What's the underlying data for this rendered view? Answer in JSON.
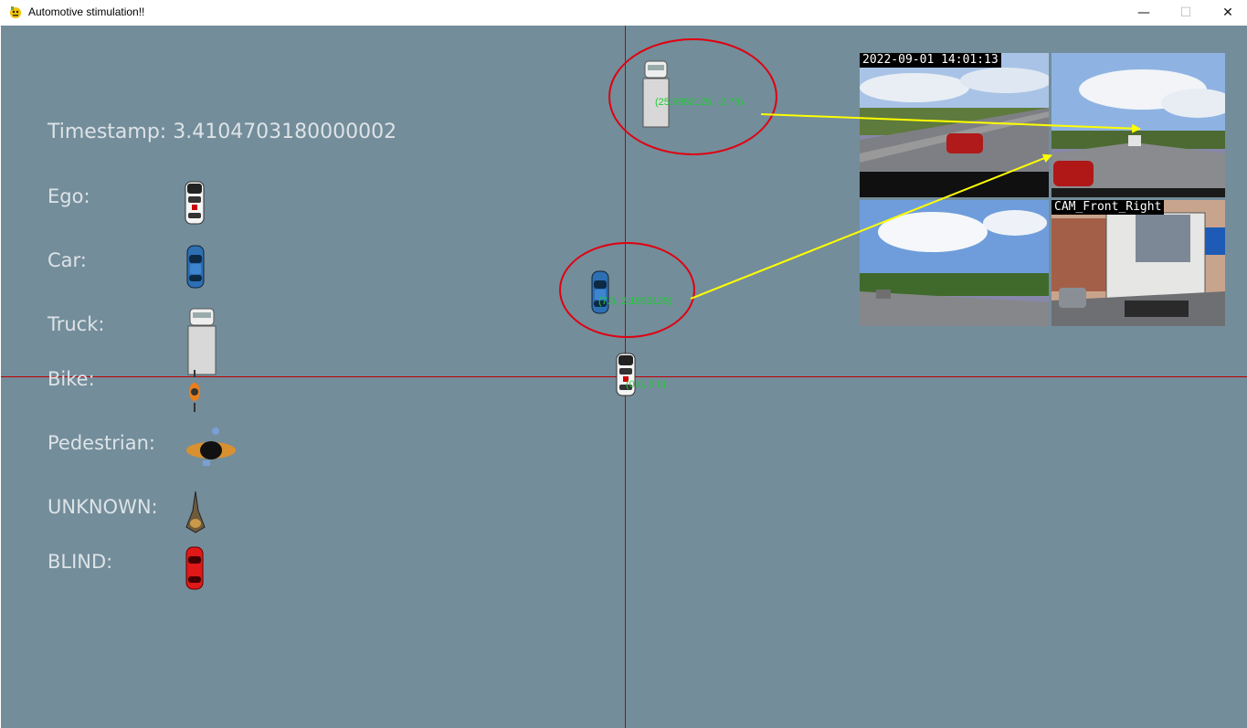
{
  "window": {
    "title": "Automotive stimulation!!",
    "controls": [
      "—",
      "☐",
      "✕"
    ]
  },
  "scene": {
    "timestamp_label": "Timestamp: 3.4104703180000002",
    "legend": [
      {
        "label": "Ego:",
        "icon": "ego-car-icon"
      },
      {
        "label": "Car:",
        "icon": "blue-car-icon"
      },
      {
        "label": "Truck:",
        "icon": "truck-icon"
      },
      {
        "label": "Bike:",
        "icon": "bike-icon"
      },
      {
        "label": "Pedestrian:",
        "icon": "pedestrian-icon"
      },
      {
        "label": "UNKNOWN:",
        "icon": "unknown-object-icon"
      },
      {
        "label": "BLIND:",
        "icon": "blind-car-icon"
      }
    ],
    "objects": {
      "ego_coord": "(0.0, 0.0)",
      "car_coord": "(7.5, 2.1953125)",
      "truck_coord": "(25.6953125, -2.75)"
    },
    "colors": {
      "background": "#738d9a",
      "axis": "#c00000",
      "highlight": "#e00010",
      "arrow": "#ffff00",
      "coord_text": "#1fcc33"
    }
  },
  "cameras": {
    "timestamp_label": "2022-09-01 14:01:13",
    "front_right_label": "CAM_Front_Right"
  }
}
